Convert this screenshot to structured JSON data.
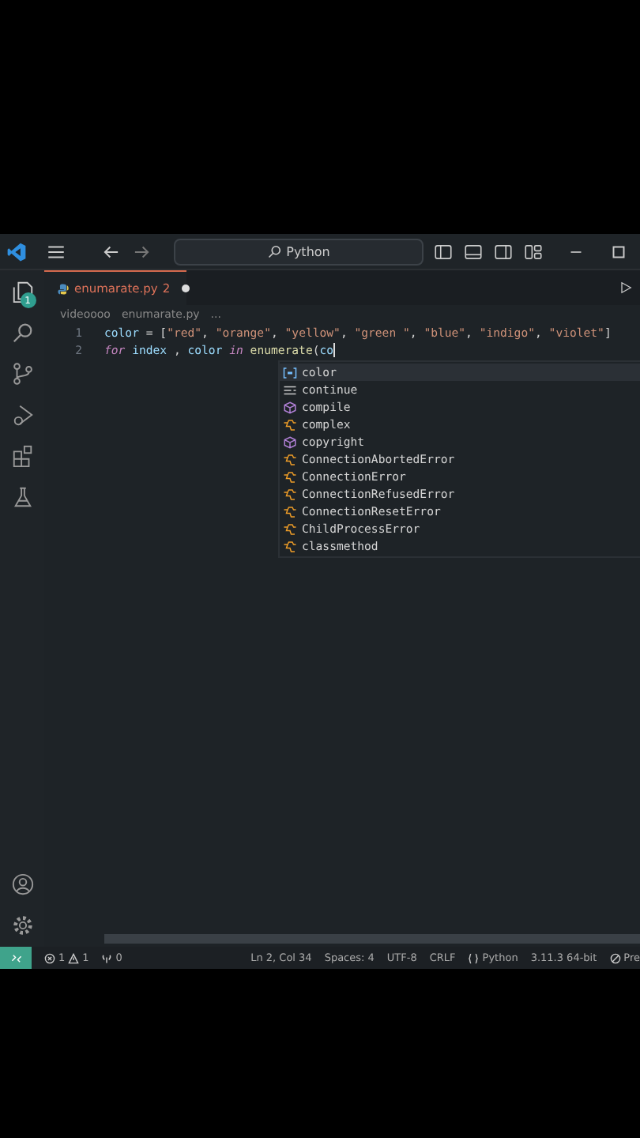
{
  "title_bar": {
    "search": "Python"
  },
  "activity_bar": {
    "explorer_badge": "1"
  },
  "tab": {
    "filename": "enumarate.py",
    "problems": "2",
    "modified": true
  },
  "breadcrumb": [
    "videoooo",
    "enumarate.py",
    "..."
  ],
  "lines": [
    {
      "number": "1",
      "tokens": [
        {
          "kind": "var",
          "text": "color"
        },
        {
          "kind": "op",
          "text": " = "
        },
        {
          "kind": "punct",
          "text": "["
        },
        {
          "kind": "str",
          "text": "\"red\""
        },
        {
          "kind": "punct",
          "text": ", "
        },
        {
          "kind": "str",
          "text": "\"orange\""
        },
        {
          "kind": "punct",
          "text": ", "
        },
        {
          "kind": "str",
          "text": "\"yellow\""
        },
        {
          "kind": "punct",
          "text": ", "
        },
        {
          "kind": "str",
          "text": "\"green \""
        },
        {
          "kind": "punct",
          "text": ", "
        },
        {
          "kind": "str",
          "text": "\"blue\""
        },
        {
          "kind": "punct",
          "text": ", "
        },
        {
          "kind": "str",
          "text": "\"indigo\""
        },
        {
          "kind": "punct",
          "text": ", "
        },
        {
          "kind": "str",
          "text": "\"violet\""
        },
        {
          "kind": "punct",
          "text": "]"
        }
      ],
      "cursor": false
    },
    {
      "number": "2",
      "tokens": [
        {
          "kind": "kw",
          "text": "for"
        },
        {
          "kind": "var",
          "text": " index "
        },
        {
          "kind": "punct",
          "text": ", "
        },
        {
          "kind": "var",
          "text": "color "
        },
        {
          "kind": "kw",
          "text": "in"
        },
        {
          "kind": "fn",
          "text": " enumerate"
        },
        {
          "kind": "punct",
          "text": "("
        },
        {
          "kind": "var",
          "text": "co"
        }
      ],
      "cursor": true
    }
  ],
  "suggestions": [
    {
      "kind": "variable",
      "label": "color",
      "selected": true
    },
    {
      "kind": "keyword",
      "label": "continue",
      "selected": false
    },
    {
      "kind": "function",
      "label": "compile",
      "selected": false
    },
    {
      "kind": "class",
      "label": "complex",
      "selected": false
    },
    {
      "kind": "function",
      "label": "copyright",
      "selected": false
    },
    {
      "kind": "class",
      "label": "ConnectionAbortedError",
      "selected": false
    },
    {
      "kind": "class",
      "label": "ConnectionError",
      "selected": false
    },
    {
      "kind": "class",
      "label": "ConnectionRefusedError",
      "selected": false
    },
    {
      "kind": "class",
      "label": "ConnectionResetError",
      "selected": false
    },
    {
      "kind": "class",
      "label": "ChildProcessError",
      "selected": false
    },
    {
      "kind": "class",
      "label": "classmethod",
      "selected": false
    }
  ],
  "status_bar": {
    "errors": "1",
    "warnings": "1",
    "ports": "0",
    "items": [
      "Ln 2, Col 34",
      "Spaces: 4",
      "UTF-8",
      "CRLF"
    ],
    "language": "Python",
    "interpreter": "3.11.3 64-bit",
    "prettier": "Pre"
  }
}
